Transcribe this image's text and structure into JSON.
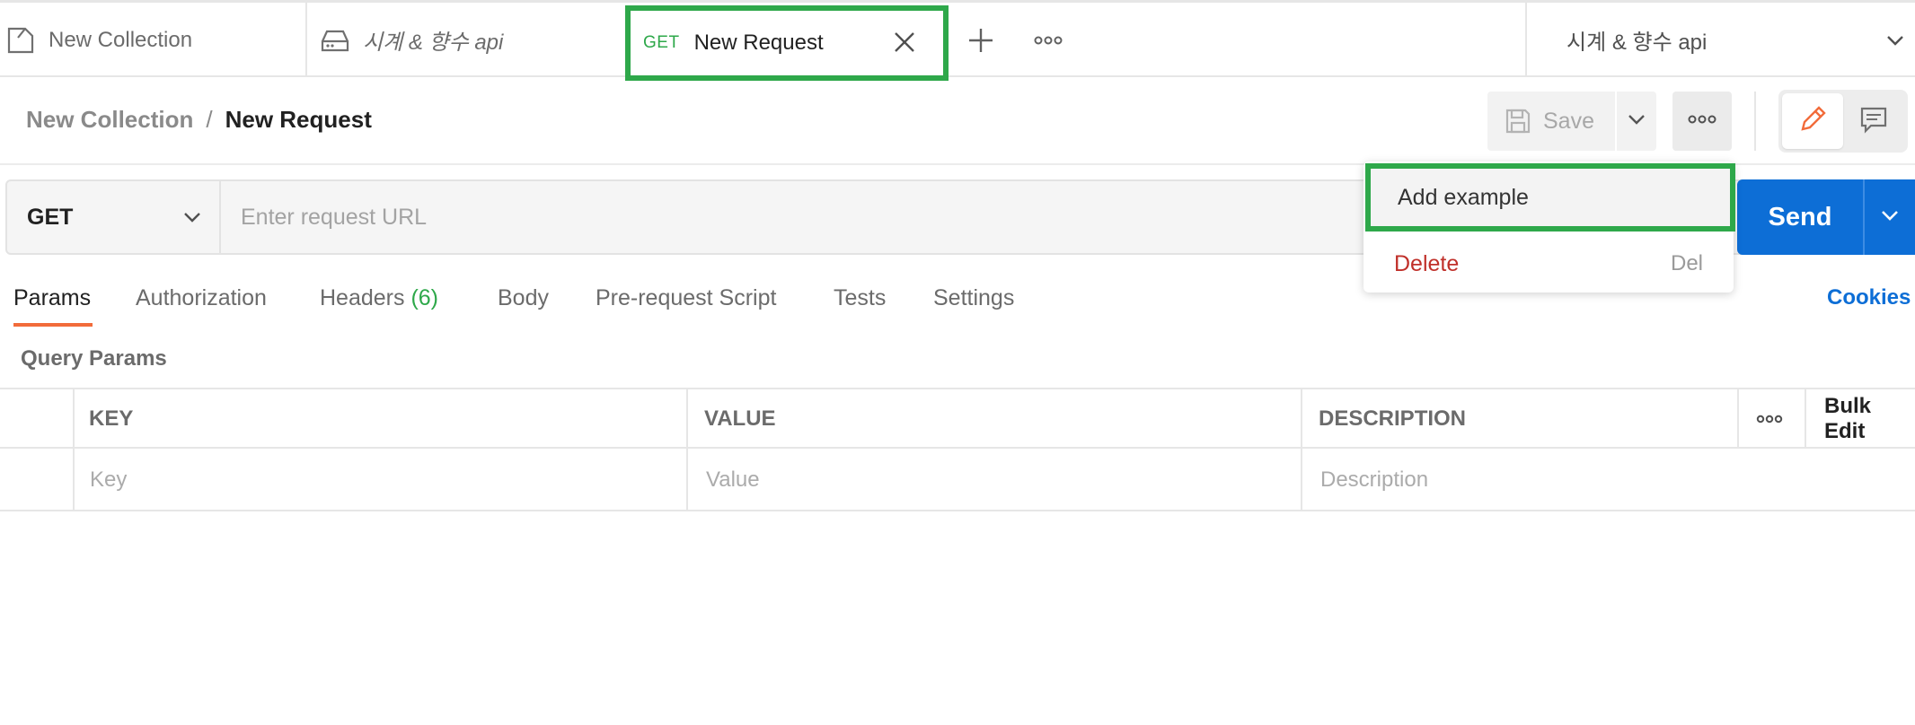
{
  "tabs": {
    "items": [
      {
        "label": "New Collection",
        "icon": "collection-icon"
      },
      {
        "label": "시계 & 향수 api",
        "icon": "environment-icon"
      },
      {
        "method": "GET",
        "label": "New Request",
        "icon": "close-icon"
      }
    ],
    "add_icon": "plus-icon",
    "more_icon": "more-icon"
  },
  "environment": {
    "selected": "시계 & 향수 api"
  },
  "breadcrumb": {
    "collection": "New Collection",
    "separator": "/",
    "request": "New Request"
  },
  "toolbar": {
    "save_label": "Save"
  },
  "request": {
    "method": "GET",
    "url_placeholder": "Enter request URL",
    "url_value": "",
    "send_label": "Send"
  },
  "menu": {
    "add_example": "Add example",
    "delete": "Delete",
    "delete_shortcut": "Del"
  },
  "request_tabs": {
    "params": "Params",
    "authorization": "Authorization",
    "headers": "Headers",
    "headers_count": "(6)",
    "body": "Body",
    "prerequest": "Pre-request Script",
    "tests": "Tests",
    "settings": "Settings",
    "cookies": "Cookies"
  },
  "query_params": {
    "title": "Query Params",
    "columns": {
      "key": "KEY",
      "value": "VALUE",
      "description": "DESCRIPTION",
      "bulk_edit": "Bulk Edit"
    },
    "placeholders": {
      "key": "Key",
      "value": "Value",
      "description": "Description"
    }
  },
  "colors": {
    "accent_green": "#2ea84a",
    "send_blue": "#0d6ed6",
    "delete_red": "#c0302a",
    "active_tab_underline": "#f26b3a"
  }
}
